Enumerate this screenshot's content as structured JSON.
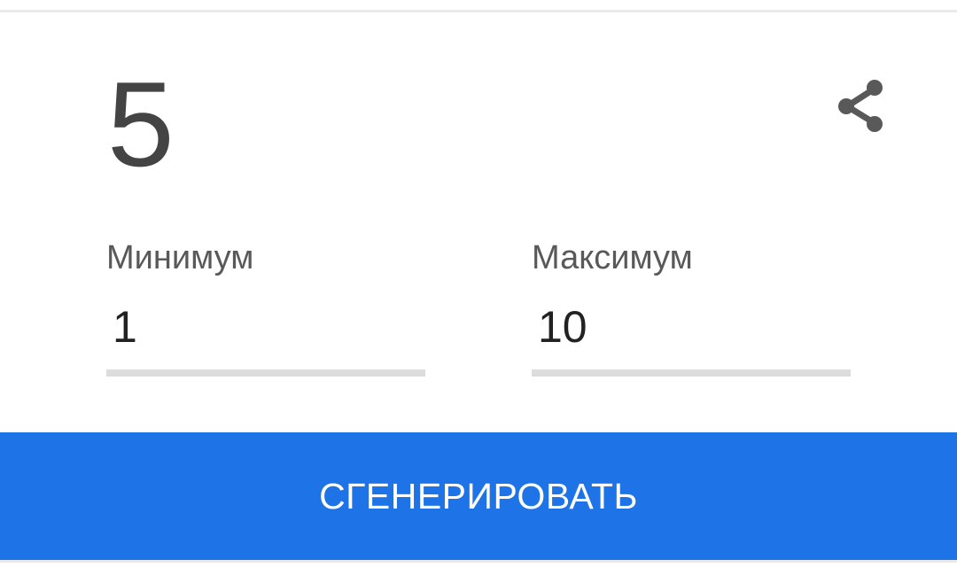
{
  "result": {
    "value": "5"
  },
  "share": {
    "icon": "share-icon"
  },
  "minimum": {
    "label": "Минимум",
    "value": "1"
  },
  "maximum": {
    "label": "Максимум",
    "value": "10"
  },
  "generate": {
    "label": "СГЕНЕРИРОВАТЬ"
  },
  "colors": {
    "accent": "#1e74e6",
    "result_text": "#444444",
    "label_text": "#595959",
    "underline": "#dcdcdc",
    "icon": "#595959"
  }
}
